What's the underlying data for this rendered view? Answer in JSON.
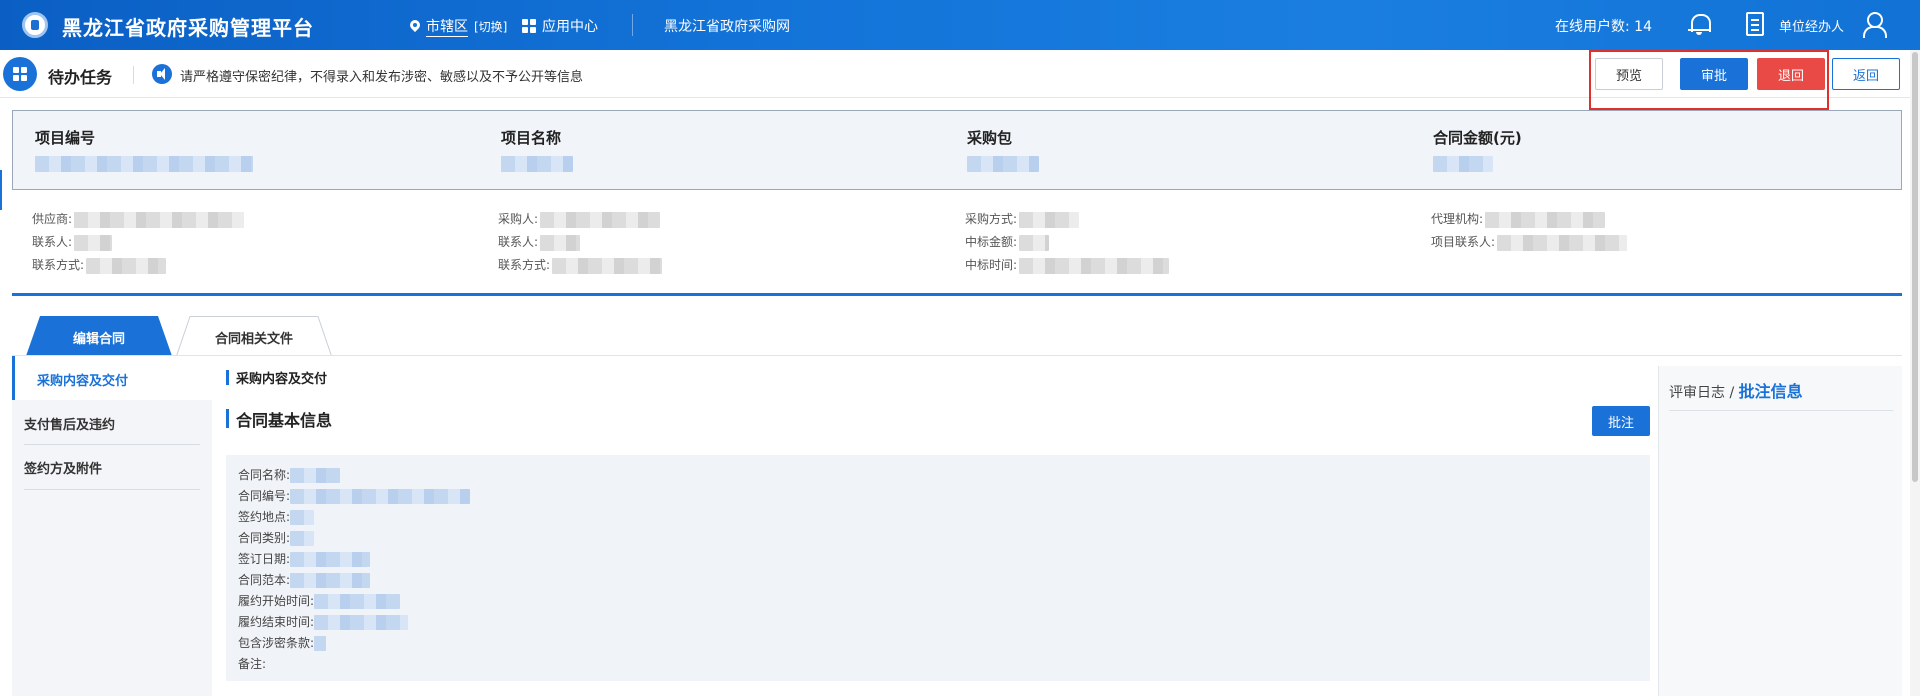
{
  "header": {
    "title": "黑龙江省政府采购管理平台",
    "region": "市辖区",
    "region_switch": "[切换]",
    "app_center": "应用中心",
    "site_link": "黑龙江省政府采购网",
    "online_users": "在线用户数: 14",
    "user_role": "单位经办人"
  },
  "taskbar": {
    "title": "待办任务",
    "notice": "请严格遵守保密纪律，不得录入和发布涉密、敏感以及不予公开等信息",
    "buttons": {
      "preview": "预览",
      "approve": "审批",
      "return": "退回",
      "back": "返回"
    }
  },
  "summary": {
    "project_no": "项目编号",
    "project_name": "项目名称",
    "package": "采购包",
    "contract_amount": "合同金额(元)"
  },
  "details": {
    "col1": [
      "供应商:",
      "联系人:",
      "联系方式:"
    ],
    "col2": [
      "采购人:",
      "联系人:",
      "联系方式:"
    ],
    "col3": [
      "采购方式:",
      "中标金额:",
      "中标时间:"
    ],
    "col4": [
      "代理机构:",
      "项目联系人:"
    ]
  },
  "tabs": {
    "edit_contract": "编辑合同",
    "related_files": "合同相关文件"
  },
  "subnav": {
    "items": [
      "采购内容及交付",
      "支付售后及违约",
      "签约方及附件"
    ]
  },
  "content": {
    "section": "采购内容及交付",
    "basic_info": "合同基本信息",
    "annotate": "批注",
    "fields": [
      "合同名称:",
      "合同编号:",
      "签约地点:",
      "合同类别:",
      "签订日期:",
      "合同范本:",
      "履约开始时间:",
      "履约结束时间:",
      "包含涉密条款:",
      "备注:"
    ]
  },
  "right_panel": {
    "log": "评审日志",
    "slash": "/",
    "annotation_info": "批注信息"
  },
  "colors": {
    "primary": "#1a72d8",
    "danger": "#e94a45",
    "highlight_box": "#e0302b"
  }
}
